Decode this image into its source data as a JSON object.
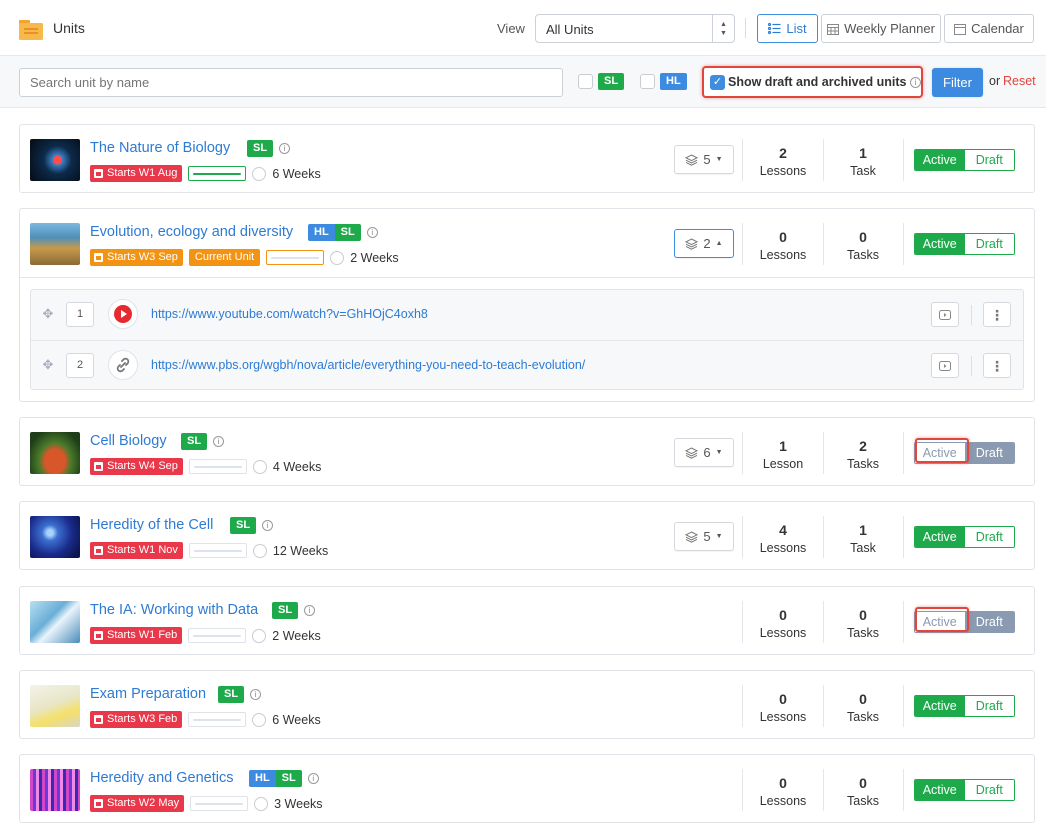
{
  "header": {
    "title": "Units",
    "view_label": "View",
    "view_select": "All Units",
    "buttons": {
      "list": "List",
      "weekly": "Weekly Planner",
      "calendar": "Calendar"
    }
  },
  "filters": {
    "search_placeholder": "Search unit by name",
    "sl": "SL",
    "hl": "HL",
    "show_draft": "Show draft and archived units",
    "filter_btn": "Filter",
    "or": "or",
    "reset": "Reset"
  },
  "units": [
    {
      "title": "The Nature of Biology",
      "tags": [
        "SL"
      ],
      "starts": "Starts W1 Aug",
      "weeks": "6 Weeks",
      "resources": "5",
      "lessons_n": "2",
      "lessons_l": "Lessons",
      "tasks_n": "1",
      "tasks_l": "Task",
      "active": "Active",
      "draft": "Draft",
      "progress": 1.0
    },
    {
      "title": "Evolution, ecology and diversity",
      "tags": [
        "HL",
        "SL"
      ],
      "starts": "Starts W3 Sep",
      "current": "Current Unit",
      "weeks": "2 Weeks",
      "resources": "2",
      "lessons_n": "0",
      "lessons_l": "Lessons",
      "tasks_n": "0",
      "tasks_l": "Tasks",
      "active": "Active",
      "draft": "Draft",
      "progress": 0
    },
    {
      "title": "Cell Biology",
      "tags": [
        "SL"
      ],
      "starts": "Starts W4 Sep",
      "weeks": "4 Weeks",
      "resources": "6",
      "lessons_n": "1",
      "lessons_l": "Lesson",
      "tasks_n": "2",
      "tasks_l": "Tasks",
      "active": "Active",
      "draft": "Draft",
      "progress": 0
    },
    {
      "title": "Heredity of the Cell",
      "tags": [
        "SL"
      ],
      "starts": "Starts W1 Nov",
      "weeks": "12 Weeks",
      "resources": "5",
      "lessons_n": "4",
      "lessons_l": "Lessons",
      "tasks_n": "1",
      "tasks_l": "Task",
      "active": "Active",
      "draft": "Draft",
      "progress": 0
    },
    {
      "title": "The IA: Working with Data",
      "tags": [
        "SL"
      ],
      "starts": "Starts W1 Feb",
      "weeks": "2 Weeks",
      "lessons_n": "0",
      "lessons_l": "Lessons",
      "tasks_n": "0",
      "tasks_l": "Tasks",
      "active": "Active",
      "draft": "Draft",
      "progress": 0
    },
    {
      "title": "Exam Preparation",
      "tags": [
        "SL"
      ],
      "starts": "Starts W3 Feb",
      "weeks": "6 Weeks",
      "lessons_n": "0",
      "lessons_l": "Lessons",
      "tasks_n": "0",
      "tasks_l": "Tasks",
      "active": "Active",
      "draft": "Draft",
      "progress": 0
    },
    {
      "title": "Heredity and Genetics",
      "tags": [
        "HL",
        "SL"
      ],
      "starts": "Starts W2 May",
      "weeks": "3 Weeks",
      "lessons_n": "0",
      "lessons_l": "Lessons",
      "tasks_n": "0",
      "tasks_l": "Tasks",
      "active": "Active",
      "draft": "Draft",
      "progress": 0
    }
  ],
  "resources": [
    {
      "num": "1",
      "url": "https://www.youtube.com/watch?v=GhHOjC4oxh8"
    },
    {
      "num": "2",
      "url": "https://www.pbs.org/wgbh/nova/article/everything-you-need-to-teach-evolution/"
    }
  ],
  "colors": {
    "accent": "#3c8be0",
    "sl": "#1eaa4b",
    "hl": "#3c8be0",
    "starts": "#e8384a",
    "current": "#f39313",
    "draft": "#8a9ab1",
    "highlight": "#e0463b"
  }
}
